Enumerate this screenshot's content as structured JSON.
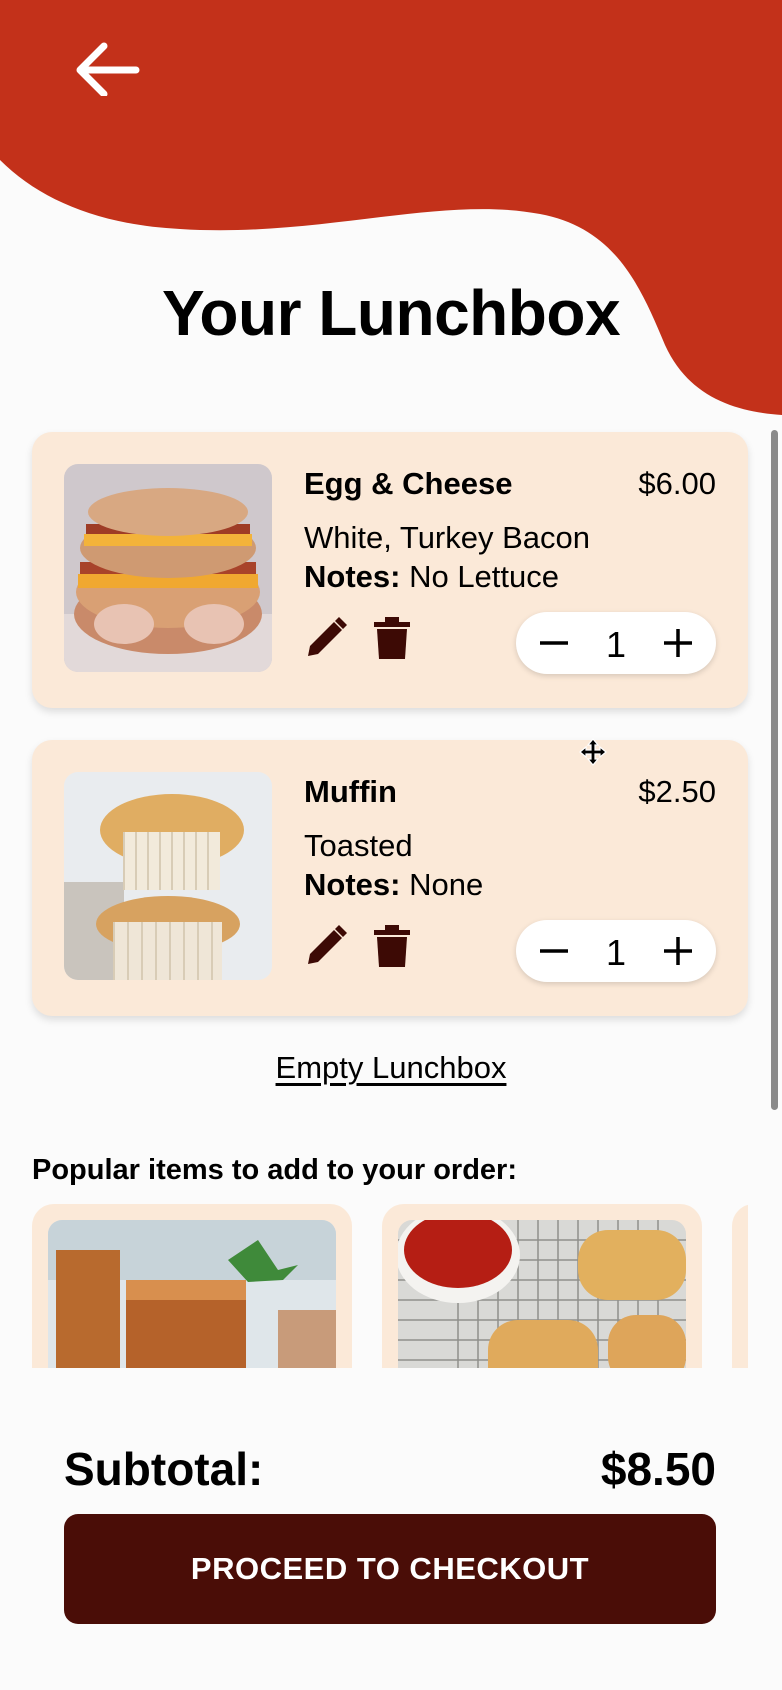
{
  "header": {
    "title": "Your Lunchbox",
    "back_icon": "arrow-left-icon"
  },
  "colors": {
    "accent": "#c3311a",
    "card_bg": "#fbe9d8",
    "button_bg": "#4a0d07",
    "icon_dark": "#3d0a05"
  },
  "cart": {
    "items": [
      {
        "name": "Egg & Cheese",
        "price": "$6.00",
        "option": "White, Turkey Bacon",
        "notes_label": "Notes:",
        "notes_value": "No Lettuce",
        "quantity": "1"
      },
      {
        "name": "Muffin",
        "price": "$2.50",
        "option": "Toasted",
        "notes_label": "Notes:",
        "notes_value": "None",
        "quantity": "1"
      }
    ],
    "empty_label": "Empty Lunchbox"
  },
  "popular": {
    "title": "Popular items to add to your order:"
  },
  "summary": {
    "subtotal_label": "Subtotal:",
    "subtotal_value": "$8.50",
    "checkout_label": "PROCEED TO CHECKOUT"
  }
}
